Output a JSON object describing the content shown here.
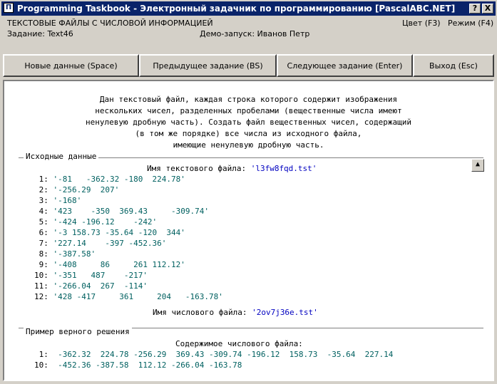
{
  "window": {
    "title": "Programming Taskbook - Электронный задачник по программированию [PascalABC.NET]",
    "app_icon": "pt-icon",
    "help_btn": "?",
    "close_btn": "X"
  },
  "header": {
    "group_title": "ТЕКСТОВЫЕ ФАЙЛЫ С ЧИСЛОВОЙ ИНФОРМАЦИЕЙ",
    "task": "Задание: Text46",
    "demo": "Демо-запуск: Иванов Петр",
    "color_label": "Цвет (F3)",
    "mode_label": "Режим (F4)"
  },
  "buttons": {
    "new_data": "Новые данные (Space)",
    "prev_task": "Предыдущее задание (BS)",
    "next_task": "Следующее задание (Enter)",
    "exit": "Выход (Esc)"
  },
  "problem": {
    "lines": [
      "Дан текстовый файл, каждая строка которого содержит изображения",
      "нескольких чисел, разделенных пробелами (вещественные числа имеют",
      "ненулевую дробную часть). Создать файл вещественных чисел, содержащий",
      "(в том же порядке) все числа из исходного файла,",
      "имеющие ненулевую дробную часть."
    ]
  },
  "source": {
    "section_label": "Исходные данные",
    "text_file_label": "Имя текстового файла:",
    "text_file_name": "'l3fw8fqd.tst'",
    "rows": [
      {
        "num": "1:",
        "text": "'-81   -362.32 -180  224.78'"
      },
      {
        "num": "2:",
        "text": "'-256.29  207'"
      },
      {
        "num": "3:",
        "text": "'-168'"
      },
      {
        "num": "4:",
        "text": "'423    -350  369.43     -309.74'"
      },
      {
        "num": "5:",
        "text": "'-424 -196.12    -242'"
      },
      {
        "num": "6:",
        "text": "'-3 158.73 -35.64 -120  344'"
      },
      {
        "num": "7:",
        "text": "'227.14    -397 -452.36'"
      },
      {
        "num": "8:",
        "text": "'-387.58'"
      },
      {
        "num": "9:",
        "text": "'-408     86     261 112.12'"
      },
      {
        "num": "10:",
        "text": "'-351   487    -217'"
      },
      {
        "num": "11:",
        "text": "'-266.04  267  -114'"
      },
      {
        "num": "12:",
        "text": "'428 -417     361     204   -163.78'"
      }
    ],
    "num_file_label": "Имя числового файла:",
    "num_file_name": "'2ov7j36e.tst'"
  },
  "solution": {
    "section_label": "Пример верного решения",
    "content_label": "Содержимое числового файла:",
    "rows": [
      {
        "num": "1:",
        "text": "-362.32  224.78 -256.29  369.43 -309.74 -196.12  158.73  -35.64  227.14"
      },
      {
        "num": "10:",
        "text": "-452.36 -387.58  112.12 -266.04 -163.78"
      }
    ]
  },
  "scroll_icon": "scroll-up-icon",
  "colors": {
    "titlebar": "#0a246a",
    "value_text": "#006060",
    "filename": "#0000c0"
  }
}
